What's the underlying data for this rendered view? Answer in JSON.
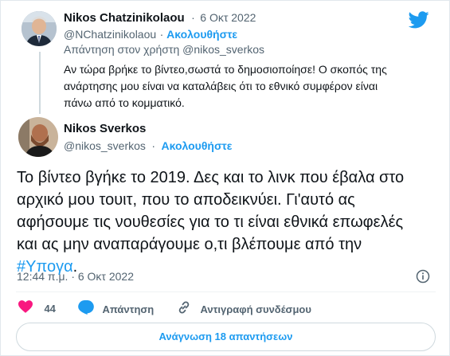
{
  "quoted_tweet": {
    "author_name": "Nikos Chatzinikolaou",
    "separator": "·",
    "date": "6 Οκτ 2022",
    "handle": "@NChatzinikolaou",
    "follow_label": "Ακολουθήστε",
    "reply_to": "Απάντηση στον χρήστη @nikos_sverkos",
    "text_lines": [
      "Αν τώρα βρήκε το βίντεο,σωστά το δημοσιοποίησε! Ο σκοπός της",
      "ανάρτησης μου είναι να καταλάβεις ότι το εθνικό συμφέρον είναι",
      "πάνω από το κομματικό."
    ]
  },
  "main_tweet": {
    "author_name": "Nikos Sverkos",
    "handle": "@nikos_sverkos",
    "separator": "·",
    "follow_label": "Ακολουθήστε",
    "text_lines": [
      "Το βίντεο βγήκε το 2019. Δες και το λινκ που έβαλα στο",
      "αρχικό μου τουιτ, που το αποδεικνύει. Γι'αυτό ας",
      "αφήσουμε τις νουθεσίες για το τι είναι εθνικά επωφελές",
      "και ας μην αναπαράγουμε ο,τι βλέπουμε από την"
    ],
    "hashtag": "#Υπογα",
    "after_hashtag": ".",
    "timestamp": "12:44 π.μ. · 6 Οκτ 2022"
  },
  "actions": {
    "likes_count": "44",
    "reply_label": "Απάντηση",
    "copy_link_label": "Αντιγραφή συνδέσμου"
  },
  "read_replies_label": "Ανάγνωση 18 απαντήσεων",
  "colors": {
    "accent": "#1d9bf0",
    "like": "#f91880",
    "text": "#0f1419",
    "muted": "#536471",
    "border": "#cfd9de"
  },
  "icons": {
    "brand": "twitter-bird-icon",
    "info": "info-icon",
    "like": "heart-icon",
    "reply": "speech-bubble-icon",
    "copy": "link-icon"
  }
}
